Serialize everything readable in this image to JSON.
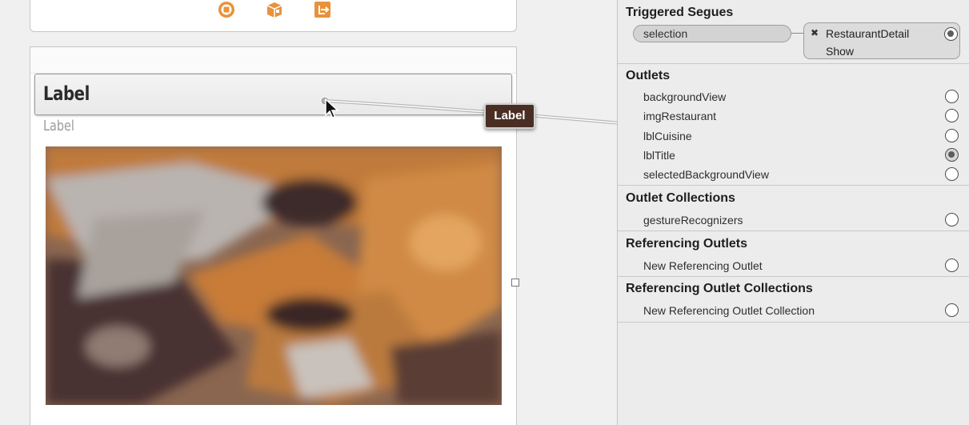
{
  "canvas": {
    "cell_title_label": "Label",
    "cell_cuisine_label": "Label",
    "drag_tooltip": "Label"
  },
  "inspector": {
    "triggered_segues": {
      "title": "Triggered Segues",
      "trigger": "selection",
      "destination": "RestaurantDetail",
      "kind": "Show",
      "remove_glyph": "✖"
    },
    "outlets": {
      "title": "Outlets",
      "items": [
        {
          "label": "backgroundView",
          "state": "empty"
        },
        {
          "label": "imgRestaurant",
          "state": "empty"
        },
        {
          "label": "lblCuisine",
          "state": "empty"
        },
        {
          "label": "lblTitle",
          "state": "connecting"
        },
        {
          "label": "selectedBackgroundView",
          "state": "empty"
        }
      ]
    },
    "outlet_collections": {
      "title": "Outlet Collections",
      "items": [
        {
          "label": "gestureRecognizers",
          "state": "empty"
        }
      ]
    },
    "referencing_outlets": {
      "title": "Referencing Outlets",
      "items": [
        {
          "label": "New Referencing Outlet",
          "state": "empty"
        }
      ]
    },
    "referencing_outlet_collections": {
      "title": "Referencing Outlet Collections",
      "items": [
        {
          "label": "New Referencing Outlet Collection",
          "state": "empty"
        }
      ]
    }
  },
  "colors": {
    "dock_icon_accent": "#e8923a",
    "tooltip_bg": "#4a2e24",
    "inspector_bg": "#ececec"
  },
  "icons": {
    "dock": [
      "first-responder-icon",
      "view-controller-icon",
      "exit-icon"
    ]
  }
}
